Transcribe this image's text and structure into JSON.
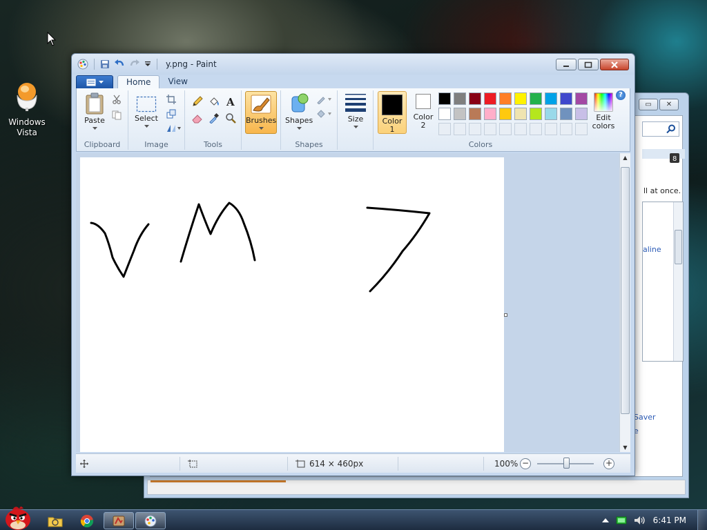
{
  "desktop": {
    "icon_label": "Windows Vista",
    "icon_name": "egg-chair-icon"
  },
  "background_window": {
    "text_1": "ll at once.",
    "text_2": "aline",
    "text_3": "Saver",
    "text_4": "e"
  },
  "paint": {
    "title": "y.png - Paint",
    "tabs": [
      "Home",
      "View"
    ],
    "groups": {
      "clipboard": {
        "label": "Clipboard",
        "paste": "Paste"
      },
      "image": {
        "label": "Image",
        "select": "Select"
      },
      "tools": {
        "label": "Tools"
      },
      "brushes": {
        "label": "Brushes"
      },
      "shapes": {
        "label": "Shapes",
        "shapes_btn": "Shapes"
      },
      "size": {
        "label": "Size"
      },
      "colors": {
        "label": "Colors",
        "color1": "Color 1",
        "color2": "Color 2",
        "edit": "Edit colors",
        "color1_value": "#000000",
        "color2_value": "#ffffff",
        "palette_row1": [
          "#000000",
          "#7f7f7f",
          "#880015",
          "#ed1c24",
          "#ff7f27",
          "#fff200",
          "#22b14c",
          "#00a2e8",
          "#3f48cc",
          "#a349a4"
        ],
        "palette_row2": [
          "#ffffff",
          "#c3c3c3",
          "#b97a57",
          "#ffaec9",
          "#ffc90e",
          "#efe4b0",
          "#b5e61d",
          "#99d9ea",
          "#7092be",
          "#c8bfe7"
        ]
      }
    },
    "status": {
      "dimensions": "614 × 460px",
      "zoom": "100%"
    },
    "canvas_strokes": [
      "V",
      "M",
      "7"
    ]
  },
  "taskbar": {
    "clock": "6:41 PM"
  }
}
